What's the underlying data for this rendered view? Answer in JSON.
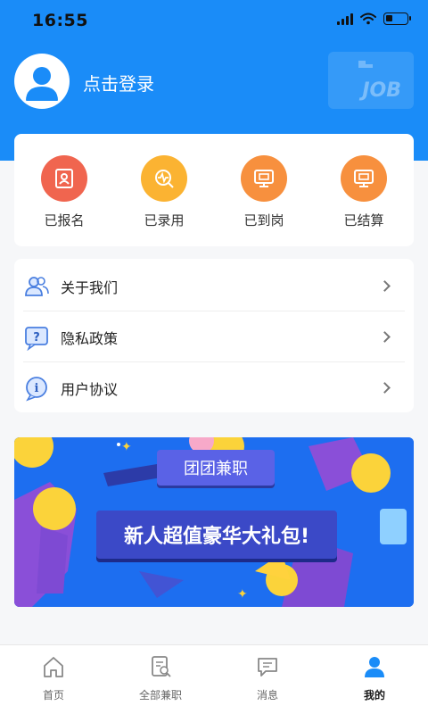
{
  "status_bar": {
    "time": "16:55"
  },
  "profile": {
    "login_text": "点击登录",
    "badge_text": "JOB"
  },
  "status_items": [
    {
      "label": "已报名",
      "color": "#f0654f",
      "icon": "form-icon"
    },
    {
      "label": "已录用",
      "color": "#fbb332",
      "icon": "pulse-icon"
    },
    {
      "label": "已到岗",
      "color": "#f7903e",
      "icon": "monitor-icon"
    },
    {
      "label": "已结算",
      "color": "#f7903e",
      "icon": "monitor-icon"
    }
  ],
  "menu": [
    {
      "label": "关于我们",
      "icon": "users-icon"
    },
    {
      "label": "隐私政策",
      "icon": "question-icon"
    },
    {
      "label": "用户协议",
      "icon": "info-icon"
    }
  ],
  "banner": {
    "tag": "团团兼职",
    "title": "新人超值豪华大礼包!"
  },
  "tabs": [
    {
      "label": "首页",
      "icon": "home-icon",
      "active": false
    },
    {
      "label": "全部兼职",
      "icon": "document-search-icon",
      "active": false
    },
    {
      "label": "消息",
      "icon": "message-icon",
      "active": false
    },
    {
      "label": "我的",
      "icon": "user-icon",
      "active": true
    }
  ],
  "colors": {
    "primary": "#1a8cf8",
    "background": "#f6f7f9"
  }
}
